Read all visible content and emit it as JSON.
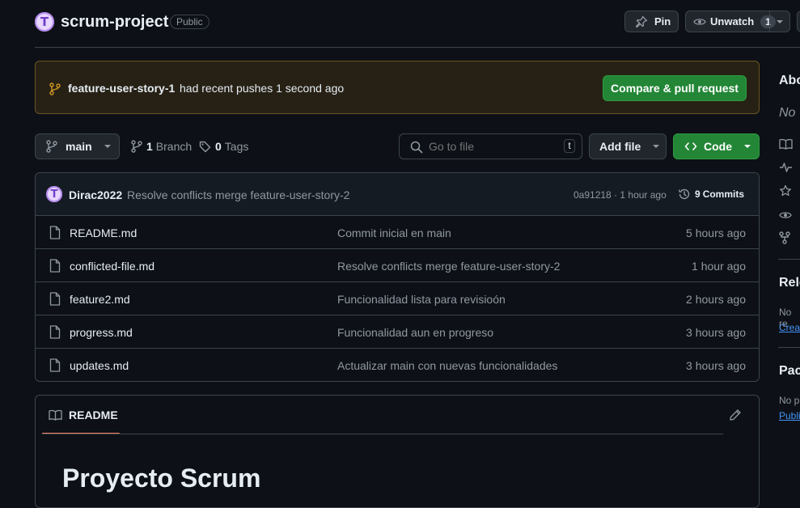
{
  "repo": {
    "avatar_letter": "T",
    "name": "scrum-project",
    "visibility": "Public"
  },
  "actions": {
    "pin_label": "Pin",
    "watch_label": "Unwatch",
    "watch_count": "1"
  },
  "banner": {
    "branch": "feature-user-story-1",
    "message": "had recent pushes 1 second ago",
    "button_label": "Compare & pull request"
  },
  "toolbar": {
    "branch_selector": "main",
    "branch_count": "1",
    "branch_label": "Branch",
    "tag_count": "0",
    "tag_label": "Tags",
    "search_placeholder": "Go to file",
    "search_shortcut": "t",
    "add_file_label": "Add file",
    "code_label": "Code"
  },
  "latest_commit": {
    "avatar_letter": "T",
    "author": "Dirac2022",
    "message": "Resolve conflicts merge feature-user-story-2",
    "hash_time": "0a91218 · 1 hour ago",
    "commits_count": "9",
    "commits_label": "Commits"
  },
  "files": [
    {
      "name": "README.md",
      "message": "Commit inicial en main",
      "time": "5 hours ago"
    },
    {
      "name": "conflicted-file.md",
      "message": "Resolve conflicts merge feature-user-story-2",
      "time": "1 hour ago"
    },
    {
      "name": "feature2.md",
      "message": "Funcionalidad lista para revisioón",
      "time": "2 hours ago"
    },
    {
      "name": "progress.md",
      "message": "Funcionalidad aun en progreso",
      "time": "3 hours ago"
    },
    {
      "name": "updates.md",
      "message": "Actualizar main con nuevas funcionalidades",
      "time": "3 hours ago"
    }
  ],
  "readme": {
    "tab_label": "README",
    "heading": "Proyecto Scrum"
  },
  "sidebar": {
    "about_heading": "Abo",
    "about_text": "No",
    "releases_heading": "Rele",
    "releases_text": "No re",
    "releases_link": "Creat",
    "packages_heading": "Pac",
    "packages_text": "No p",
    "packages_link": "Publi"
  },
  "colors": {
    "background": "#0d1117",
    "border": "#3d444d",
    "accent_green": "#238636",
    "banner_bg": "#272115",
    "banner_border": "#6b5421",
    "link_blue": "#4493f8",
    "muted_text": "#9198a1"
  }
}
